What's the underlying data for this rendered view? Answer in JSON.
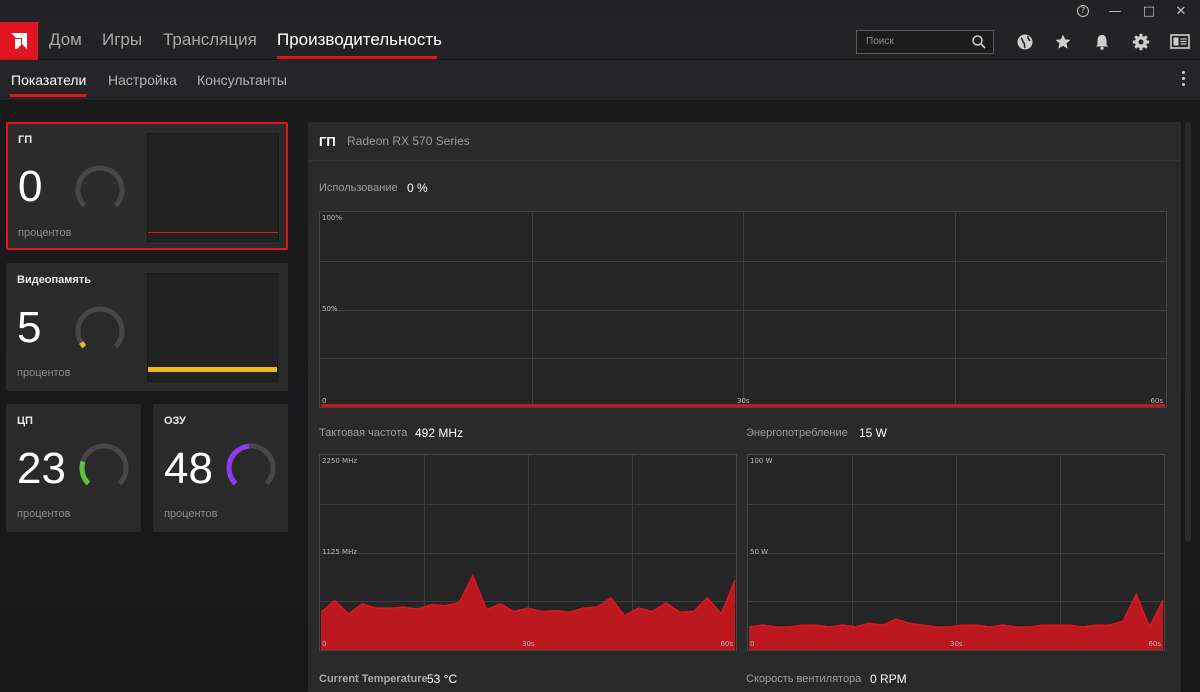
{
  "window": {
    "help_glyph": "?",
    "minimize_glyph": "—",
    "maximize_glyph": "□",
    "close_glyph": "✕"
  },
  "nav": {
    "items": [
      "Дом",
      "Игры",
      "Трансляция",
      "Производительность"
    ],
    "active_index": 3,
    "search_placeholder": "Поиск",
    "icons": [
      "globe-icon",
      "star-icon",
      "bell-icon",
      "gear-icon",
      "display-icon"
    ]
  },
  "subnav": {
    "items": [
      "Показатели",
      "Настройка",
      "Консультанты"
    ],
    "active_index": 0
  },
  "cards": {
    "gpu": {
      "title": "ГП",
      "value": "0",
      "unit": "процентов",
      "percent": 0,
      "color": "#e0151f"
    },
    "vram": {
      "title": "Видеопамять",
      "value": "5",
      "unit": "процентов",
      "percent": 5,
      "color": "#f0b81a"
    },
    "cpu": {
      "title": "ЦП",
      "value": "23",
      "unit": "процентов",
      "percent": 23,
      "color": "#5dc43a"
    },
    "ram": {
      "title": "ОЗУ",
      "value": "48",
      "unit": "процентов",
      "percent": 48,
      "color": "#8e3bf0"
    }
  },
  "panel": {
    "title": "ГП",
    "subtitle": "Radeon RX 570 Series",
    "usage_label": "Использование",
    "usage_value": "0 %",
    "clock_label": "Тактовая частота",
    "clock_value": "492 MHz",
    "power_label": "Энергопотребление",
    "power_value": "15 W",
    "temp_label": "Current Temperature",
    "temp_value": "53 °C",
    "fan_label": "Скорость вентилятора",
    "fan_value": "0 RPM"
  },
  "graphs": {
    "usage": {
      "y_ticks": [
        "100%",
        "50%",
        "0"
      ],
      "x_ticks": [
        "30s",
        "60s"
      ],
      "ymax": 100,
      "values": [
        0,
        0,
        0,
        0,
        0,
        0,
        0,
        0,
        0,
        0,
        0,
        0,
        0,
        0,
        0,
        0,
        0,
        0,
        0,
        0,
        0,
        0,
        0,
        0,
        0,
        0,
        0,
        0,
        0,
        0,
        0
      ]
    },
    "clock": {
      "y_ticks": [
        "2250 MHz",
        "1125 MHz",
        "0"
      ],
      "x_ticks": [
        "30s",
        "60s"
      ],
      "ymax": 2250,
      "values": [
        420,
        560,
        400,
        520,
        470,
        470,
        480,
        460,
        510,
        500,
        530,
        850,
        450,
        520,
        430,
        470,
        430,
        440,
        420,
        470,
        480,
        590,
        380,
        470,
        430,
        530,
        420,
        430,
        590,
        400,
        800
      ]
    },
    "power": {
      "y_ticks": [
        "100 W",
        "50 W",
        "0"
      ],
      "x_ticks": [
        "30s",
        "60s"
      ],
      "ymax": 100,
      "values": [
        11,
        12,
        11,
        11,
        12,
        12,
        11,
        12,
        11,
        13,
        12,
        15,
        13,
        12,
        11,
        11,
        12,
        12,
        11,
        12,
        11,
        11,
        12,
        12,
        12,
        11,
        12,
        12,
        14,
        28,
        11,
        25
      ]
    }
  }
}
